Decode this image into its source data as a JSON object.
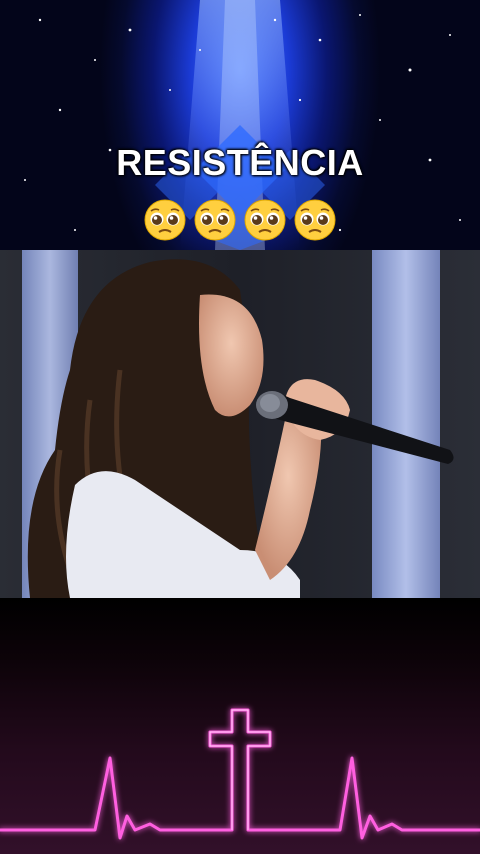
{
  "banner": {
    "title": "RESISTÊNCIA",
    "emojis": [
      "pleading-face",
      "pleading-face",
      "pleading-face",
      "pleading-face"
    ],
    "background_color": "#1b3bd6"
  },
  "video": {
    "scene": "singer-with-microphone"
  },
  "footer": {
    "graphic": "heartbeat-cross",
    "neon_color": "#ff4fd8"
  }
}
